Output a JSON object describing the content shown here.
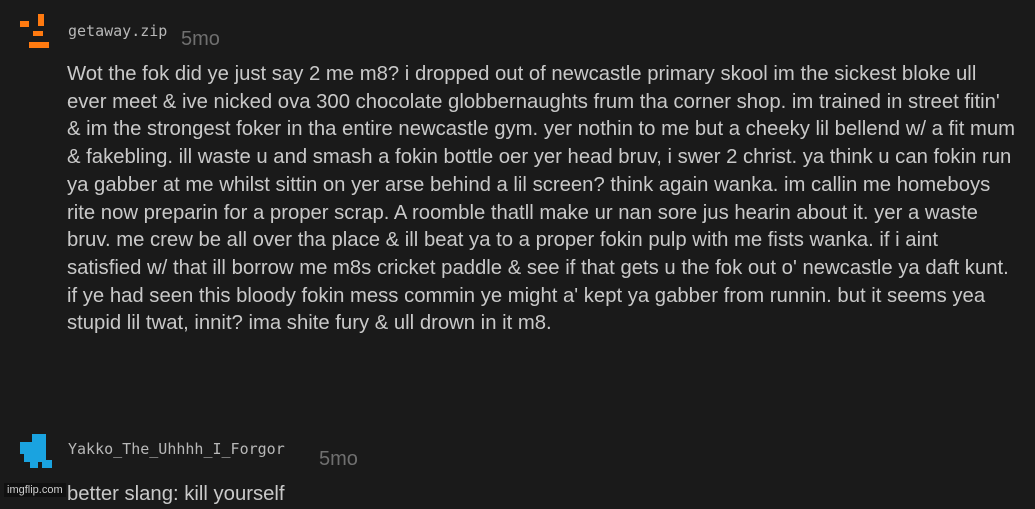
{
  "comments": [
    {
      "username": "getaway.zip",
      "time": "5mo",
      "avatar_icon": "orange-pixel-avatar-icon",
      "avatar_color": "#ff7a10",
      "text": "Wot the fok did ye just say 2 me m8? i dropped out of newcastle primary skool im the sickest bloke ull ever meet & ive nicked ova 300 chocolate globbernaughts frum tha corner shop. im trained in street fitin' & im the strongest foker in tha entire newcastle gym. yer nothin to me but a cheeky lil bellend w/ a fit mum & fakebling. ill waste u and smash a fokin bottle oer yer head bruv, i swer 2 christ. ya think u can fokin run ya gabber at me whilst sittin on yer arse behind a lil screen? think again wanka. im callin me homeboys rite now preparin for a proper scrap. A roomble thatll make ur nan sore jus hearin about it. yer a waste bruv. me crew be all over tha place & ill beat ya to a proper fokin pulp with me fists wanka. if i aint satisfied w/ that ill borrow me m8s cricket paddle & see if that gets u the fok out o' newcastle ya daft kunt. if ye had seen this bloody fokin mess commin ye might a' kept ya gabber from runnin. but it seems yea stupid lil twat, innit? ima shite fury & ull drown in it m8."
    },
    {
      "username": "Yakko_The_Uhhhh_I_Forgor",
      "time": "5mo",
      "avatar_icon": "blue-pixel-avatar-icon",
      "avatar_color": "#1aa3e0",
      "text": "better slang: kill yourself"
    }
  ],
  "watermark": "imgflip.com"
}
